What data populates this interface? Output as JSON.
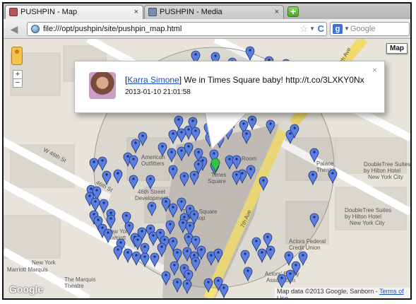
{
  "tabs": [
    {
      "label": "PUSHPIN - Map",
      "active": true,
      "close": "×"
    },
    {
      "label": "PUSHPIN - Media",
      "active": false,
      "close": "×"
    }
  ],
  "new_tab_symbol": "+",
  "toolbar": {
    "back_symbol": "◀",
    "url": "file:///opt/pushpin/site/pushpin_map.html",
    "star_symbol": "☆",
    "dropdown_symbol": "▼",
    "reload_symbol": "C",
    "search_engine_letter": "g",
    "search_placeholder": "Google"
  },
  "map": {
    "map_type_button": "Map",
    "zoom_in": "+",
    "zoom_out": "−",
    "streets": [
      "W 46th St",
      "46th St",
      "W 47th St",
      "7th Ave",
      "7th Ave",
      "W 4"
    ],
    "places": [
      "American",
      "Outfitters",
      "Times",
      "Square",
      "46th Street",
      "Development",
      "Times Square",
      "Gift Shop",
      "New York",
      "Marriott",
      "The Marquis",
      "Theatre",
      "New York",
      "Marriott Marquis",
      "Actors Federal",
      "Credit Union",
      "Actors' Equity",
      "Association",
      "Palace",
      "Theatre",
      "DoubleTree Suites",
      "by Hilton Hotel",
      "New York City",
      "DoubleTree Suites",
      "by Hilton Hotel",
      "New York City",
      "Room",
      "tre",
      "Ar",
      "The"
    ],
    "popup": {
      "user": "Karra Simone",
      "bracket_open": "[",
      "bracket_close": "]",
      "text": " We in Times Square baby! http://t.co/3LXKY0Nx",
      "timestamp": "2013-01-10 21:01:58",
      "close": "×"
    },
    "credit_text": "Map data ©2013 Google, Sanborn - ",
    "terms": "Terms of Use",
    "google_logo": "Google",
    "colors": {
      "pin_blue": "#5b7fe0",
      "pin_green": "#34c24a",
      "road_yellow": "#f6e27a",
      "map_bg": "#e8e4dc"
    }
  }
}
